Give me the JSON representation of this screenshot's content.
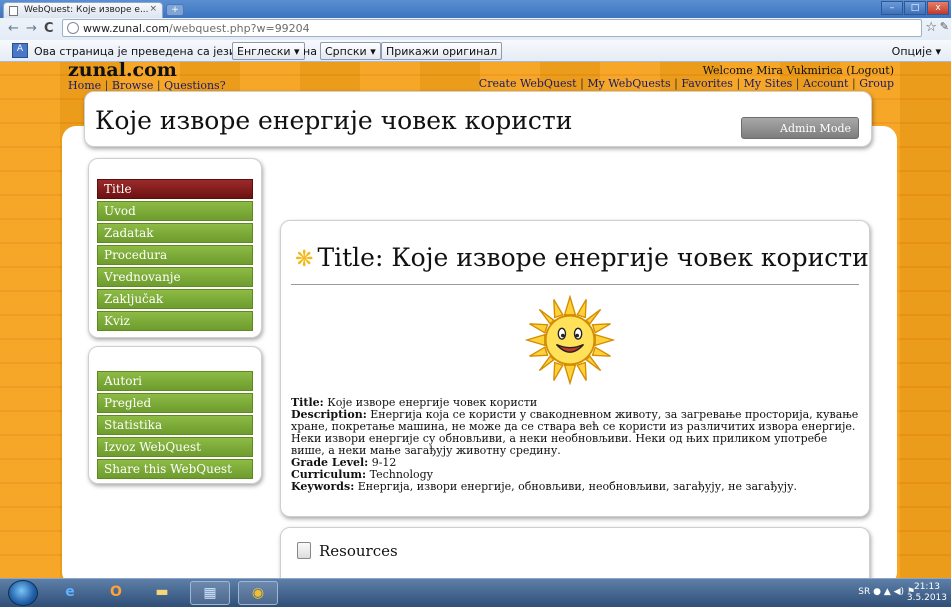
{
  "browser": {
    "tab_title": "WebQuest: Које изворе е...",
    "tab_close": "×",
    "new_tab": "+",
    "url_host": "www.zunal.com",
    "url_path": "/webquest.php?w=99204",
    "nav_back": "←",
    "nav_forward": "→",
    "nav_reload": "C",
    "star": "☆",
    "min": "–",
    "max": "□",
    "close": "x"
  },
  "translate_bar": {
    "message": "Ова страница је преведена са језика",
    "from_lang": "Енглески ▾",
    "to_word": "на",
    "to_lang": "Српски ▾",
    "show_original": "Прикажи оригинал",
    "options": "Опције ▾"
  },
  "site": {
    "logo": "zunal.com",
    "nav_home": "Home",
    "nav_browse": "Browse",
    "nav_questions": "Questions?",
    "sep": "|",
    "welcome": "Welcome Mira Vukmirica (Logout)",
    "top_links": [
      "Create WebQuest",
      "My WebQuests",
      "Favorites",
      "My Sites",
      "Account",
      "Group"
    ]
  },
  "page_title": "Које изворе енергије човек користи",
  "admin_mode": "Admin Mode",
  "menu_primary": [
    "Title",
    "Uvod",
    "Zadatak",
    "Procedura",
    "Vrednovanje",
    "Zaključak",
    "Kviz"
  ],
  "menu_secondary": [
    "Autori",
    "Pregled",
    "Statistika",
    "Izvoz WebQuest",
    "Share this WebQuest"
  ],
  "content": {
    "heading": "Title: Које изворе енергије човек користи",
    "flower": "❋",
    "title_label": "Title:",
    "title_value": "Које изворе енергије човек користи",
    "description_label": "Description:",
    "description_value": "Енергија која се користи у свакодневном животу, за загревање просторија, кување хране, покретање машина, не може да се ствара већ се користи из различитих извора енергије. Неки извори енергије су обновљиви, а неки необновљиви. Неки од њих приликом употребе више, а неки мање загађују животну средину.",
    "grade_label": "Grade Level:",
    "grade_value": "9-12",
    "curriculum_label": "Curriculum:",
    "curriculum_value": "Technology",
    "keywords_label": "Keywords:",
    "keywords_value": "Енергија, извори енергије, обновљиви, необновљиви, загађују, не загађују."
  },
  "resources_title": "Resources",
  "taskbar": {
    "tray_text": "SR",
    "clock_time": "21:13",
    "clock_date": "3.5.2013"
  },
  "colors": {
    "menu_green": "#7aa83a",
    "menu_active": "#8a1f1f",
    "page_orange": "#f3a01f"
  }
}
